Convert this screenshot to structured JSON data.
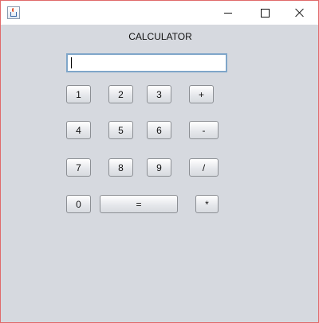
{
  "window": {
    "title": "",
    "controls": [
      "minimize-icon",
      "maximize-icon",
      "close-icon"
    ]
  },
  "calculator": {
    "title": "CALCULATOR",
    "display_value": "",
    "keys": {
      "k1": "1",
      "k2": "2",
      "k3": "3",
      "plus": "+",
      "k4": "4",
      "k5": "5",
      "k6": "6",
      "minus": "-",
      "k7": "7",
      "k8": "8",
      "k9": "9",
      "divide": "/",
      "k0": "0",
      "equals": "=",
      "multiply": "*"
    }
  },
  "colors": {
    "window_bg": "#d6d9df",
    "border": "#e06a6a",
    "display_border": "#7fa6c9"
  }
}
